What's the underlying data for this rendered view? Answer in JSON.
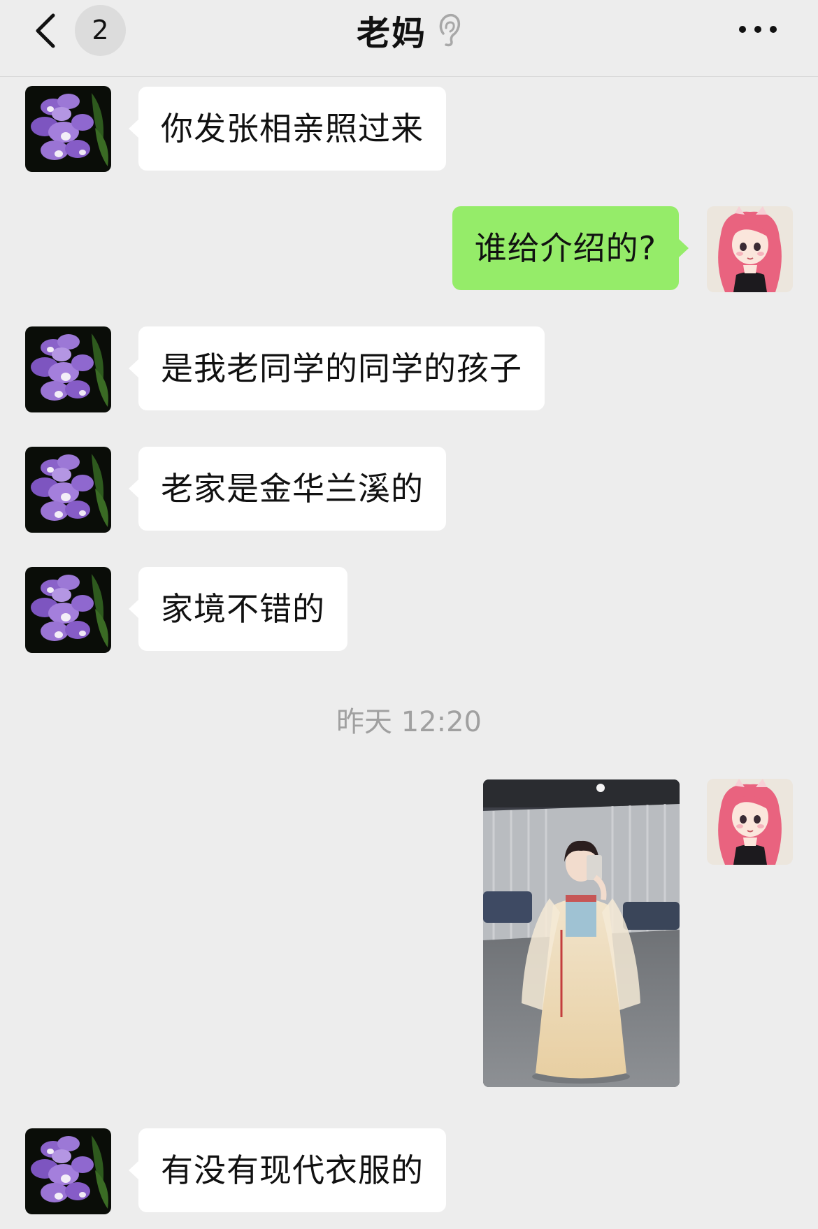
{
  "header": {
    "back_icon": "chevron-left-icon",
    "unread_count": "2",
    "title": "老妈",
    "mute_icon": "ear-icon",
    "more_icon": "more-dots-icon"
  },
  "contacts": {
    "mom_avatar": "purple-orchid-avatar",
    "me_avatar": "pink-hair-girl-avatar"
  },
  "messages": [
    {
      "sender": "mom",
      "text": "你发张相亲照过来"
    },
    {
      "sender": "me",
      "text": "谁给介绍的?"
    },
    {
      "sender": "mom",
      "text": "是我老同学的同学的孩子"
    },
    {
      "sender": "mom",
      "text": "老家是金华兰溪的"
    },
    {
      "sender": "mom",
      "text": "家境不错的"
    },
    {
      "type": "timestamp",
      "text": "昨天 12:20"
    },
    {
      "sender": "me",
      "type": "image",
      "content": "photo-of-girl-in-hanfu"
    },
    {
      "sender": "mom",
      "text": "有没有现代衣服的"
    }
  ],
  "colors": {
    "background": "#ededed",
    "incoming_bubble": "#ffffff",
    "outgoing_bubble": "#95ec69",
    "timestamp_text": "#a0a0a0"
  }
}
